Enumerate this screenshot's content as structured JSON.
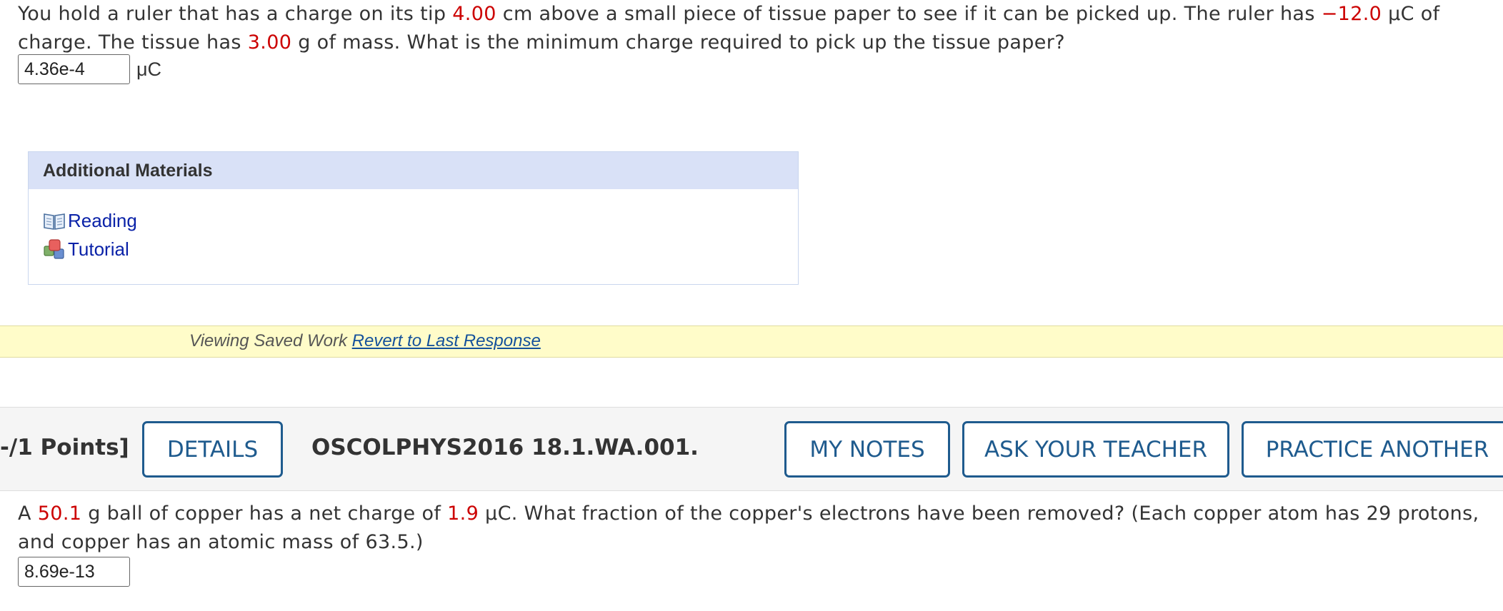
{
  "question1": {
    "text_part1": "You hold a ruler that has a charge on its tip ",
    "distance_value": "4.00",
    "text_part2": " cm above a small piece of tissue paper to see if it can be picked up. The ruler has ",
    "charge_value": "−12.0",
    "text_part3": " μC  of charge. The tissue has ",
    "mass_value": "3.00",
    "text_part4": " g of mass. What is the minimum charge required to pick up the tissue paper?",
    "answer_value": "4.36e-4",
    "answer_unit": "μC"
  },
  "additional_materials": {
    "title": "Additional Materials",
    "links": [
      {
        "label": "Reading",
        "icon": "book-icon"
      },
      {
        "label": "Tutorial",
        "icon": "tutorial-icon"
      }
    ]
  },
  "saved_work": {
    "label": "Viewing Saved Work ",
    "revert_link": "Revert to Last Response"
  },
  "question2_header": {
    "points": "-/1 Points]",
    "details_button": "DETAILS",
    "question_id": "OSCOLPHYS2016 18.1.WA.001.",
    "my_notes_button": "MY NOTES",
    "ask_teacher_button": "ASK YOUR TEACHER",
    "practice_button": "PRACTICE ANOTHER"
  },
  "question2": {
    "text_part1": "A ",
    "mass_value": "50.1",
    "text_part2": " g ball of copper has a net charge of ",
    "charge_value": "1.9",
    "text_part3": " μC. What fraction of the copper's electrons have been removed? (Each copper atom has 29 protons, and copper has an atomic mass of 63.5.)",
    "answer_value": "8.69e-13"
  },
  "colors": {
    "given_value_red": "#cc0000",
    "button_blue": "#1f5b8e",
    "link_blue": "#0a22a8",
    "saved_bar_yellow": "#fffcc9",
    "panel_header_blue": "#d9e1f7"
  }
}
